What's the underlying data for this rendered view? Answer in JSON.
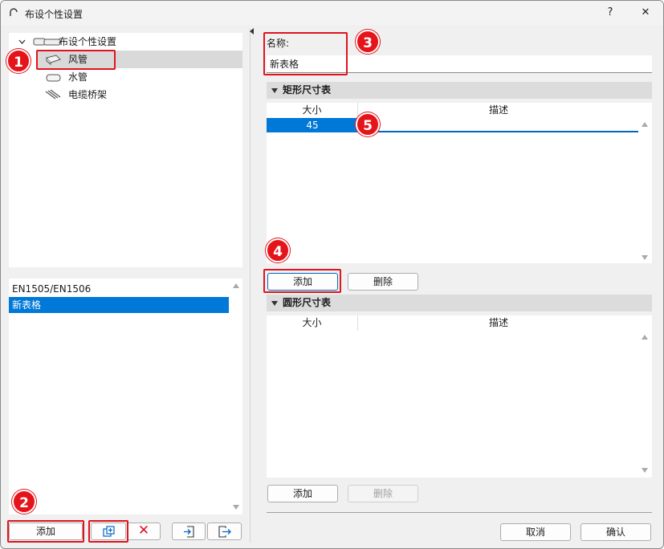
{
  "window": {
    "title": "布设个性设置",
    "help_label": "?",
    "close_label": "✕"
  },
  "tree": {
    "root": "布设个性设置",
    "items": [
      {
        "label": "风管",
        "selected": true
      },
      {
        "label": "水管",
        "selected": false
      },
      {
        "label": "电缆桥架",
        "selected": false
      }
    ]
  },
  "table_list": {
    "items": [
      {
        "label": "EN1505/EN1506",
        "selected": false
      },
      {
        "label": "新表格",
        "selected": true
      }
    ]
  },
  "left_toolbar": {
    "add_label": "添加",
    "delete_symbol": "✕"
  },
  "name_field": {
    "label": "名称:",
    "value": "新表格"
  },
  "rect_section": {
    "title": "矩形尺寸表",
    "col_size": "大小",
    "col_desc": "描述",
    "rows": [
      {
        "size": "45",
        "desc": ""
      }
    ],
    "add_label": "添加",
    "delete_label": "删除"
  },
  "round_section": {
    "title": "圆形尺寸表",
    "col_size": "大小",
    "col_desc": "描述",
    "add_label": "添加",
    "delete_label": "删除"
  },
  "footer": {
    "cancel_label": "取消",
    "ok_label": "确认"
  },
  "badges": [
    "1",
    "2",
    "3",
    "4",
    "5"
  ],
  "colors": {
    "annotation_red": "#e5141b",
    "selection_blue": "#0078d7"
  }
}
